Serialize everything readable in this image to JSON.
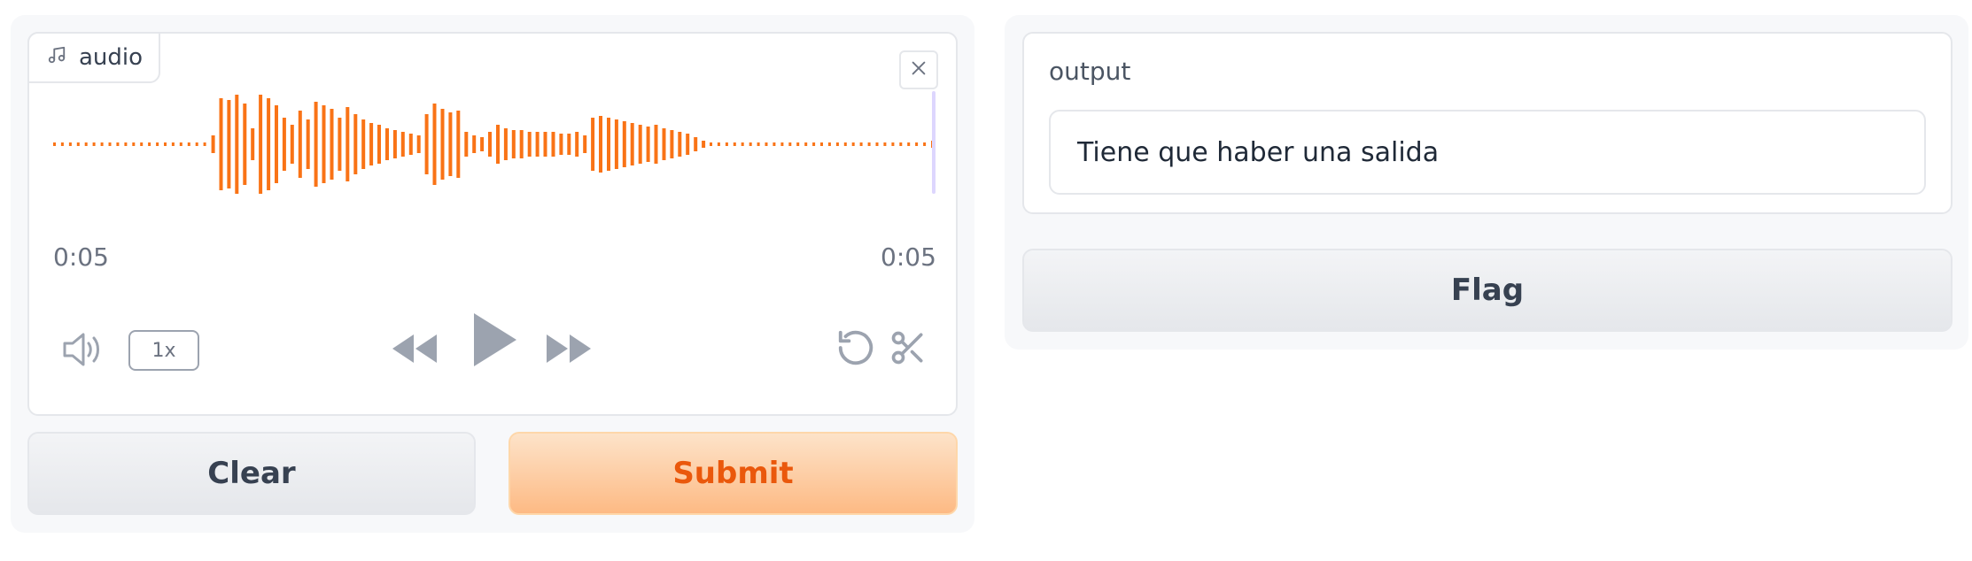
{
  "audio": {
    "label": "audio",
    "time_current": "0:05",
    "time_total": "0:05",
    "playback_rate": "1x",
    "waveform_color": "#f97316",
    "icons": {
      "label": "music-note-icon",
      "close": "close-icon",
      "volume": "volume-icon",
      "rewind": "rewind-icon",
      "play": "play-icon",
      "forward": "fast-forward-icon",
      "reset": "undo-icon",
      "trim": "scissors-icon"
    }
  },
  "actions": {
    "clear_label": "Clear",
    "submit_label": "Submit"
  },
  "output": {
    "label": "output",
    "value": "Tiene que haber una salida"
  },
  "flag": {
    "label": "Flag"
  },
  "colors": {
    "accent": "#ea580c",
    "submit_bg": "#fdba84",
    "panel_bg": "#f7f8fa",
    "border": "#e5e7eb"
  }
}
